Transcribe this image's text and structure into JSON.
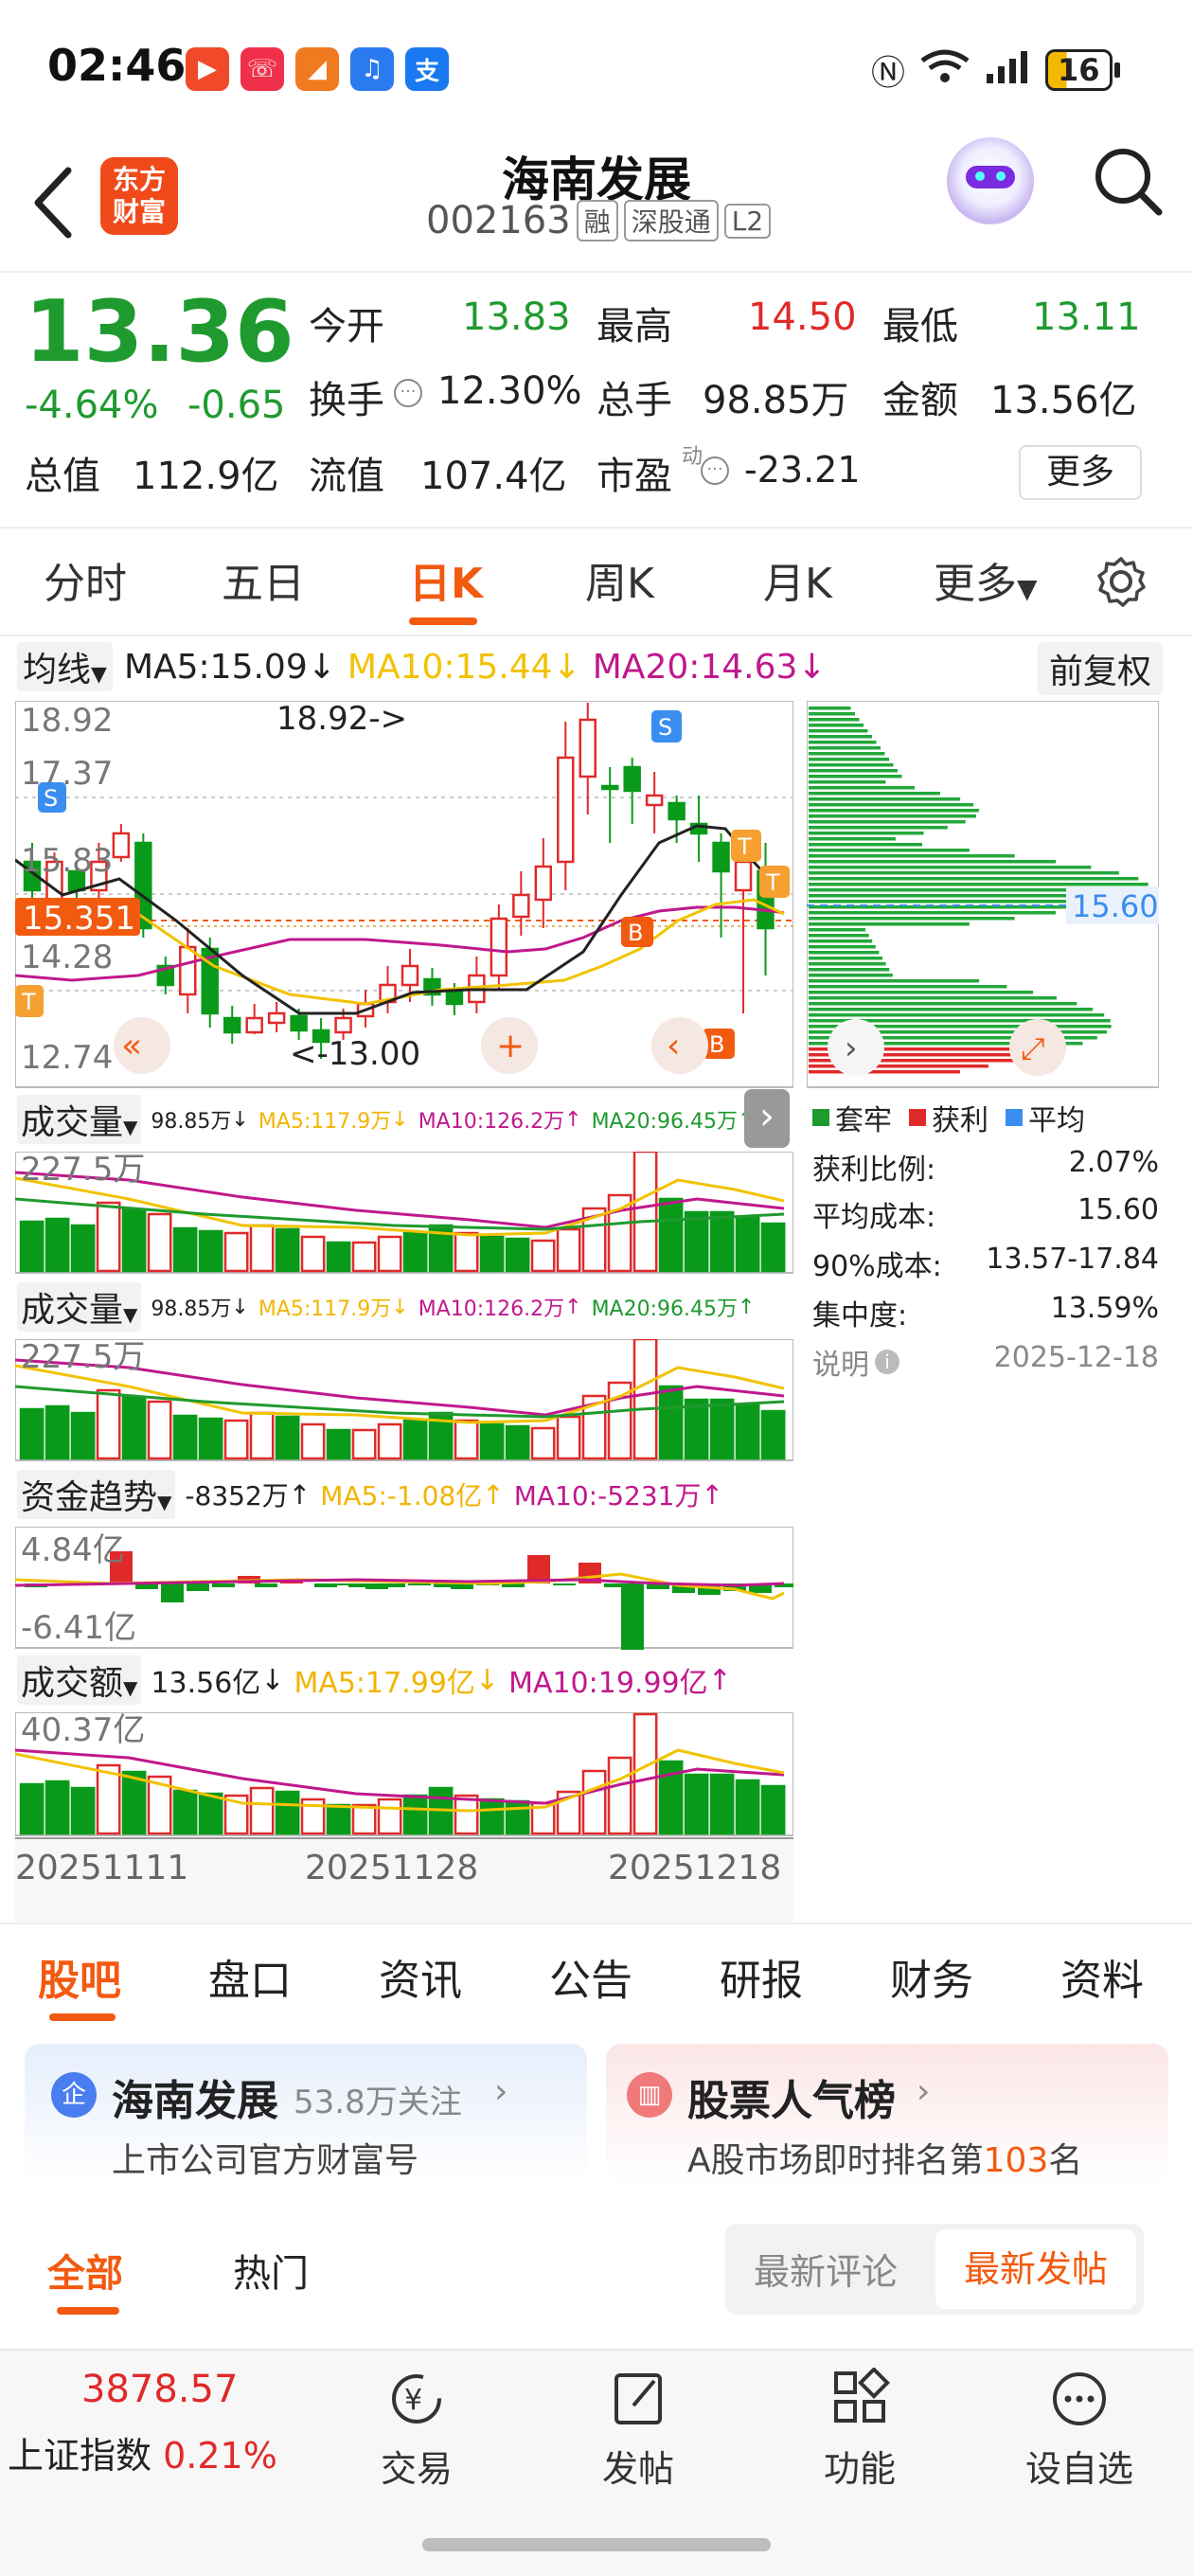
{
  "status_bar": {
    "time": "02:46",
    "battery": "16"
  },
  "header": {
    "title": "海南发展",
    "code": "002163",
    "chips": [
      "融",
      "深股通",
      "L2"
    ],
    "logo_text": [
      "东方",
      "财富"
    ]
  },
  "quote": {
    "price": "13.36",
    "change_pct": "-4.64%",
    "change": "-0.65",
    "open_label": "今开",
    "open": "13.83",
    "high_label": "最高",
    "high": "14.50",
    "low_label": "最低",
    "low": "13.11",
    "turnover_label": "换手",
    "turnover": "12.30%",
    "volume_label": "总手",
    "volume": "98.85万",
    "amount_label": "金额",
    "amount": "13.56亿",
    "mktcap_label": "总值",
    "mktcap": "112.9亿",
    "float_label": "流值",
    "float": "107.4亿",
    "pe_label": "市盈",
    "pe_sup": "动",
    "pe": "-23.21",
    "more_button": "更多"
  },
  "period_tabs": [
    "分时",
    "五日",
    "日K",
    "周K",
    "月K",
    "更多"
  ],
  "active_period": "日K",
  "ma_bar": {
    "selector": "均线",
    "ma5": "MA5:15.09",
    "ma10": "MA10:15.44",
    "ma20": "MA20:14.63",
    "adjust": "前复权"
  },
  "kline": {
    "y_labels": [
      "18.92",
      "17.37",
      "15.83",
      "14.28",
      "12.74"
    ],
    "cross_price": "15.351",
    "high_annot": "18.92->",
    "low_annot": "<-13.00",
    "colors": {
      "up": "#e02a2a",
      "down": "#0a9a1a",
      "ma5": "#222222",
      "ma10": "#f2c200",
      "ma20": "#c0188c"
    }
  },
  "chip_dist": {
    "avg_label": "15.60"
  },
  "vol_panel_1": {
    "selector": "成交量",
    "value": "98.85万",
    "ma5": "MA5:117.9万",
    "ma10": "MA10:126.2万",
    "ma20": "MA20:96.45万",
    "top": "227.5万"
  },
  "vol_panel_2": {
    "selector": "成交量",
    "value": "98.85万",
    "ma5": "MA5:117.9万",
    "ma10": "MA10:126.2万",
    "ma20": "MA20:96.45万",
    "top": "227.5万"
  },
  "fund_panel": {
    "selector": "资金趋势",
    "value": "-8352万",
    "ma5": "MA5:-1.08亿",
    "ma10": "MA10:-5231万",
    "top": "4.84亿",
    "bottom": "-6.41亿"
  },
  "amount_panel": {
    "selector": "成交额",
    "value": "13.56亿",
    "ma5": "MA5:17.99亿",
    "ma10": "MA10:19.99亿",
    "top": "40.37亿"
  },
  "dates": [
    "20251111",
    "20251128",
    "20251218"
  ],
  "chip_legend": {
    "trapped": "套牢",
    "profit": "获利",
    "avg": "平均"
  },
  "chip_stats": [
    {
      "label": "获利比例:",
      "value": "2.07%"
    },
    {
      "label": "平均成本:",
      "value": "15.60"
    },
    {
      "label": "90%成本:",
      "value": "13.57-17.84"
    },
    {
      "label": "集中度:",
      "value": "13.59%"
    }
  ],
  "chip_note": {
    "label": "说明",
    "date": "2025-12-18"
  },
  "bottom_tabs": [
    "股吧",
    "盘口",
    "资讯",
    "公告",
    "研报",
    "财务",
    "资料"
  ],
  "cards": {
    "left_title": "海南发展",
    "left_follow": "53.8万关注",
    "left_sub": "上市公司官方财富号",
    "left_badge": "企",
    "right_title": "股票人气榜",
    "right_sub_pre": "A股市场即时排名第",
    "right_rank": "103",
    "right_sub_post": "名"
  },
  "feed_tabs": {
    "all": "全部",
    "hot": "热门",
    "latest_comment": "最新评论",
    "latest_post": "最新发帖"
  },
  "index": {
    "value": "3878.57",
    "name": "上证指数",
    "pct": "0.21%"
  },
  "nav": [
    "交易",
    "发帖",
    "功能",
    "设自选"
  ]
}
